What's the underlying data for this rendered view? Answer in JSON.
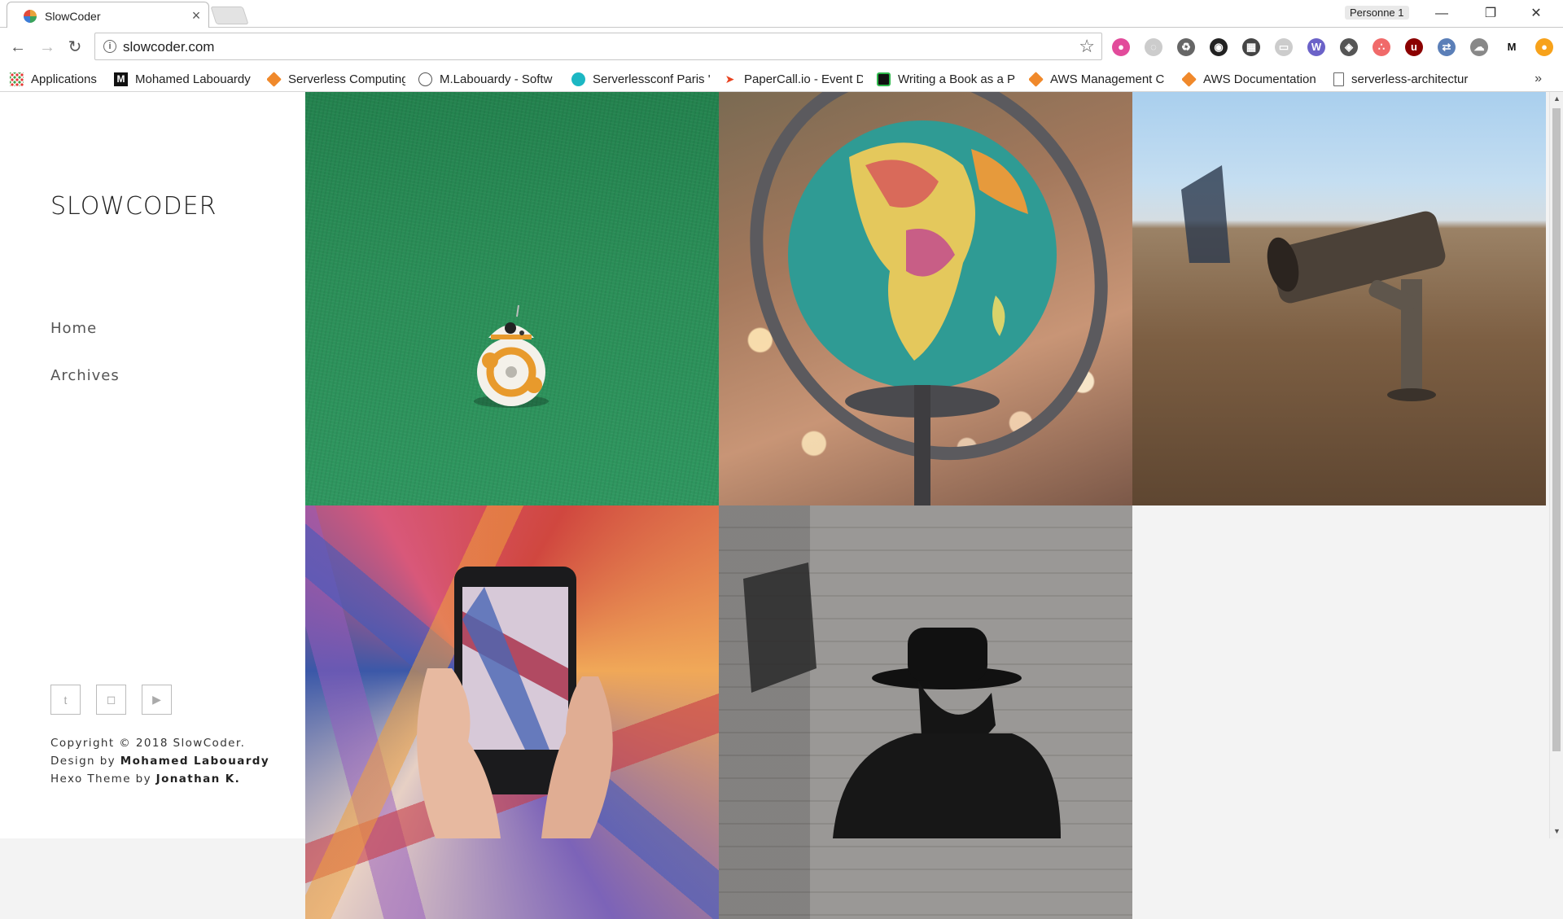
{
  "browser": {
    "tab_title": "SlowCoder",
    "tab_close": "×",
    "profile": "Personne 1",
    "window_controls": {
      "minimize": "—",
      "restore": "❐",
      "close": "✕"
    },
    "nav": {
      "back": "←",
      "forward": "→",
      "reload": "↻"
    },
    "url": "slowcoder.com",
    "bookmark_star": "☆",
    "extensions": [
      "color-wheel-icon",
      "grammar-icon",
      "recycle-icon",
      "camera-lens-icon",
      "film-icon",
      "cast-icon",
      "wappalyzer-icon",
      "shield-icon",
      "asana-icon",
      "ublock-icon",
      "translate-icon",
      "cloud-icon",
      "medium-icon",
      "honey-icon"
    ]
  },
  "bookmarks": [
    {
      "label": "Applications",
      "icon": "apps-icon"
    },
    {
      "label": "Mohamed Labouardy",
      "icon": "medium-icon"
    },
    {
      "label": "Serverless Computing",
      "icon": "aws-cube-icon"
    },
    {
      "label": "M.Labouardy - Softw",
      "icon": "circle-icon"
    },
    {
      "label": "Serverlessconf Paris '",
      "icon": "serverless-icon"
    },
    {
      "label": "PaperCall.io - Event D",
      "icon": "papercall-icon"
    },
    {
      "label": "Writing a Book as a P",
      "icon": "leanpub-icon"
    },
    {
      "label": "AWS Management C",
      "icon": "aws-cube-icon"
    },
    {
      "label": "AWS Documentation",
      "icon": "aws-cube-icon"
    },
    {
      "label": "serverless-architectur",
      "icon": "document-icon"
    }
  ],
  "bookmarks_more": "»",
  "site": {
    "title": "SLOWCODER",
    "nav": {
      "home": "Home",
      "archives": "Archives"
    },
    "social": [
      {
        "name": "twitter-icon",
        "glyph": "t"
      },
      {
        "name": "instagram-icon",
        "glyph": "◻"
      },
      {
        "name": "youtube-icon",
        "glyph": "▶"
      }
    ],
    "footer": {
      "copyright": "Copyright © 2018 SlowCoder.",
      "design_prefix": "Design by ",
      "design_author": "Mohamed Labouardy",
      "theme_prefix": "Hexo Theme by ",
      "theme_author": "Jonathan K."
    }
  },
  "scrollbar": {
    "up": "▲",
    "down": "▼"
  }
}
